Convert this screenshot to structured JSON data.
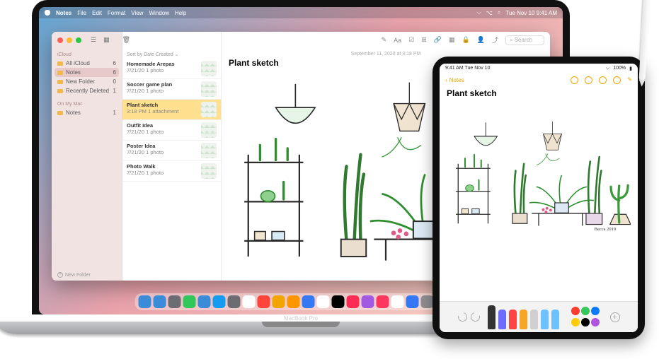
{
  "menubar": {
    "app": "Notes",
    "items": [
      "File",
      "Edit",
      "Format",
      "View",
      "Window",
      "Help"
    ],
    "clock": "Tue Nov 10  9:41 AM"
  },
  "sidebar": {
    "section_icloud": "iCloud",
    "items": [
      {
        "label": "All iCloud",
        "count": "6"
      },
      {
        "label": "Notes",
        "count": "6"
      },
      {
        "label": "New Folder",
        "count": "0"
      },
      {
        "label": "Recently Deleted",
        "count": "1"
      }
    ],
    "section_mac": "On My Mac",
    "mac_items": [
      {
        "label": "Notes",
        "count": "1"
      }
    ],
    "new_folder": "New Folder"
  },
  "list": {
    "sort": "Sort by Date Created",
    "items": [
      {
        "title": "Homemade Arepas",
        "sub": "7/21/20   1 photo"
      },
      {
        "title": "Soccer game plan",
        "sub": "7/21/20   1 photo"
      },
      {
        "title": "Plant sketch",
        "sub": "3:18 PM   1 attachment"
      },
      {
        "title": "Outfit Idea",
        "sub": "7/21/20   1 photo"
      },
      {
        "title": "Poster Idea",
        "sub": "7/21/20   1 photo"
      },
      {
        "title": "Photo Walk",
        "sub": "7/21/20   1 photo"
      }
    ],
    "selected_index": 2
  },
  "content": {
    "date": "September 11, 2020 at 3:18 PM",
    "title": "Plant sketch",
    "signature": "Becca 2019"
  },
  "toolbar": {
    "search_placeholder": "Search"
  },
  "mac_label": "MacBook Pro",
  "dock_colors": [
    "#3a8bd8",
    "#3a8bd8",
    "#6c6c72",
    "#31c759",
    "#3a8bd8",
    "#139cf0",
    "#6c6c72",
    "#fff",
    "#ff443a",
    "#f0a500",
    "#ff9500",
    "#3578f4",
    "#fff",
    "#000",
    "#ff2d55",
    "#a259e4",
    "#ff375f",
    "#fff",
    "#3478f6",
    "#8e8e93",
    "#5e5ce6",
    "#6c6c72"
  ],
  "ipad": {
    "status_time": "9:41 AM  Tue Nov 10",
    "battery": "100%",
    "back": "Notes",
    "title": "Plant sketch",
    "tool_colors": [
      "#333",
      "#6c6cff",
      "#f44",
      "#f6a623",
      "#d0d0d0",
      "#6ec1ff",
      "#6ec1ff"
    ],
    "palette": [
      "#ff3b30",
      "#34c759",
      "#0a7aff",
      "#ffcc00",
      "#000000",
      "#af52de"
    ]
  }
}
